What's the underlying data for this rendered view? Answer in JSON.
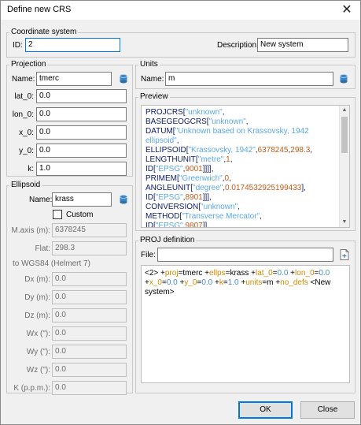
{
  "window": {
    "title": "Define new CRS",
    "close_glyph": "✕"
  },
  "coordinate_system": {
    "group_title": "Coordinate system",
    "id_label": "ID:",
    "id_value": "2",
    "description_label": "Description:",
    "description_value": "New system"
  },
  "projection": {
    "group_title": "Projection",
    "name_label": "Name:",
    "name_value": "tmerc",
    "params": [
      {
        "label": "lat_0:",
        "value": "0.0"
      },
      {
        "label": "lon_0:",
        "value": "0.0"
      },
      {
        "label": "x_0:",
        "value": "0.0"
      },
      {
        "label": "y_0:",
        "value": "0.0"
      },
      {
        "label": "k:",
        "value": "1.0"
      }
    ]
  },
  "units": {
    "group_title": "Units",
    "name_label": "Name:",
    "name_value": "m"
  },
  "preview": {
    "group_title": "Preview",
    "lines": [
      [
        {
          "t": "PROJCRS[",
          "c": "k"
        },
        {
          "t": "\"unknown\"",
          "c": "s"
        },
        {
          "t": ",",
          "c": "k"
        }
      ],
      [
        {
          "t": "    BASEGEOGCRS[",
          "c": "k"
        },
        {
          "t": "\"unknown\"",
          "c": "s"
        },
        {
          "t": ",",
          "c": "k"
        }
      ],
      [
        {
          "t": "        DATUM[",
          "c": "k"
        },
        {
          "t": "\"Unknown based on Krassovsky, 1942",
          "c": "s"
        }
      ],
      [
        {
          "t": "ellipsoid\"",
          "c": "s"
        },
        {
          "t": ",",
          "c": "k"
        }
      ],
      [
        {
          "t": "            ELLIPSOID[",
          "c": "k"
        },
        {
          "t": "\"Krassovsky, 1942\"",
          "c": "s"
        },
        {
          "t": ",",
          "c": "k"
        },
        {
          "t": "6378245",
          "c": "n"
        },
        {
          "t": ",",
          "c": "k"
        },
        {
          "t": "298.3",
          "c": "n"
        },
        {
          "t": ",",
          "c": "k"
        }
      ],
      [
        {
          "t": "                LENGTHUNIT[",
          "c": "k"
        },
        {
          "t": "\"metre\"",
          "c": "s"
        },
        {
          "t": ",",
          "c": "k"
        },
        {
          "t": "1",
          "c": "n"
        },
        {
          "t": ",",
          "c": "k"
        }
      ],
      [
        {
          "t": "                    ID[",
          "c": "k"
        },
        {
          "t": "\"EPSG\"",
          "c": "s"
        },
        {
          "t": ",",
          "c": "k"
        },
        {
          "t": "9001",
          "c": "n"
        },
        {
          "t": "]]]],",
          "c": "k"
        }
      ],
      [
        {
          "t": "        PRIMEM[",
          "c": "k"
        },
        {
          "t": "\"Greenwich\"",
          "c": "s"
        },
        {
          "t": ",",
          "c": "k"
        },
        {
          "t": "0",
          "c": "n"
        },
        {
          "t": ",",
          "c": "k"
        }
      ],
      [
        {
          "t": "            ANGLEUNIT[",
          "c": "k"
        },
        {
          "t": "\"degree\"",
          "c": "s"
        },
        {
          "t": ",",
          "c": "k"
        },
        {
          "t": "0.0174532925199433",
          "c": "n"
        },
        {
          "t": "],",
          "c": "k"
        }
      ],
      [
        {
          "t": "            ID[",
          "c": "k"
        },
        {
          "t": "\"EPSG\"",
          "c": "s"
        },
        {
          "t": ",",
          "c": "k"
        },
        {
          "t": "8901",
          "c": "n"
        },
        {
          "t": "]]],",
          "c": "k"
        }
      ],
      [
        {
          "t": "    CONVERSION[",
          "c": "k"
        },
        {
          "t": "\"unknown\"",
          "c": "s"
        },
        {
          "t": ",",
          "c": "k"
        }
      ],
      [
        {
          "t": "        METHOD[",
          "c": "k"
        },
        {
          "t": "\"Transverse Mercator\"",
          "c": "s"
        },
        {
          "t": ",",
          "c": "k"
        }
      ],
      [
        {
          "t": "            ID[",
          "c": "k"
        },
        {
          "t": "\"EPSG\"",
          "c": "s"
        },
        {
          "t": ",",
          "c": "k"
        },
        {
          "t": "9807",
          "c": "n"
        },
        {
          "t": "]],",
          "c": "k"
        }
      ]
    ]
  },
  "ellipsoid": {
    "group_title": "Ellipsoid",
    "name_label": "Name:",
    "name_value": "krass",
    "custom_label": "Custom",
    "custom_checked": false,
    "maxis_label": "M.axis (m):",
    "maxis_value": "6378245",
    "flat_label": "Flat:",
    "flat_value": "298.3",
    "to_wgs84_label": "to WGS84 (Helmert 7)",
    "helmert": [
      {
        "label": "Dx (m):",
        "value": "0.0"
      },
      {
        "label": "Dy (m):",
        "value": "0.0"
      },
      {
        "label": "Dz (m):",
        "value": "0.0"
      },
      {
        "label": "Wx (\"):",
        "value": "0.0"
      },
      {
        "label": "Wy (\"):",
        "value": "0.0"
      },
      {
        "label": "Wz (\"):",
        "value": "0.0"
      },
      {
        "label": "K (p.p.m.):",
        "value": "0.0"
      }
    ]
  },
  "proj_definition": {
    "group_title": "PROJ definition",
    "file_label": "File:",
    "file_value": "",
    "line1": [
      {
        "t": "<2> ",
        "c": "pd"
      },
      {
        "t": " +",
        "c": "pd"
      },
      {
        "t": "proj",
        "c": "pk"
      },
      {
        "t": "=tmerc",
        "c": "pd"
      },
      {
        "t": " +",
        "c": "pd"
      },
      {
        "t": "ellps",
        "c": "pk"
      },
      {
        "t": "=krass",
        "c": "pd"
      },
      {
        "t": " +",
        "c": "pd"
      },
      {
        "t": "lat_0",
        "c": "pk"
      },
      {
        "t": "=",
        "c": "pd"
      },
      {
        "t": "0.0",
        "c": "pv"
      },
      {
        "t": " +",
        "c": "pd"
      },
      {
        "t": "lon_0",
        "c": "pk"
      },
      {
        "t": "=",
        "c": "pd"
      },
      {
        "t": "0.0",
        "c": "pv"
      }
    ],
    "line2": [
      {
        "t": "+",
        "c": "pd"
      },
      {
        "t": "x_0",
        "c": "pk"
      },
      {
        "t": "=",
        "c": "pd"
      },
      {
        "t": "0.0",
        "c": "pv"
      },
      {
        "t": " +",
        "c": "pd"
      },
      {
        "t": "y_0",
        "c": "pk"
      },
      {
        "t": "=",
        "c": "pd"
      },
      {
        "t": "0.0",
        "c": "pv"
      },
      {
        "t": " +",
        "c": "pd"
      },
      {
        "t": "k",
        "c": "pk"
      },
      {
        "t": "=",
        "c": "pd"
      },
      {
        "t": "1.0",
        "c": "pv"
      },
      {
        "t": " +",
        "c": "pd"
      },
      {
        "t": "units",
        "c": "pk"
      },
      {
        "t": "=m",
        "c": "pd"
      },
      {
        "t": " +",
        "c": "pd"
      },
      {
        "t": "no_defs",
        "c": "pk"
      },
      {
        "t": " <New",
        "c": "pd"
      }
    ],
    "line3": [
      {
        "t": "system>",
        "c": "pd"
      }
    ]
  },
  "buttons": {
    "ok": "OK",
    "close": "Close"
  },
  "icons": {
    "database": "database-icon",
    "file": "file-icon",
    "close": "close-icon"
  },
  "colors": {
    "accent": "#0078d7"
  }
}
